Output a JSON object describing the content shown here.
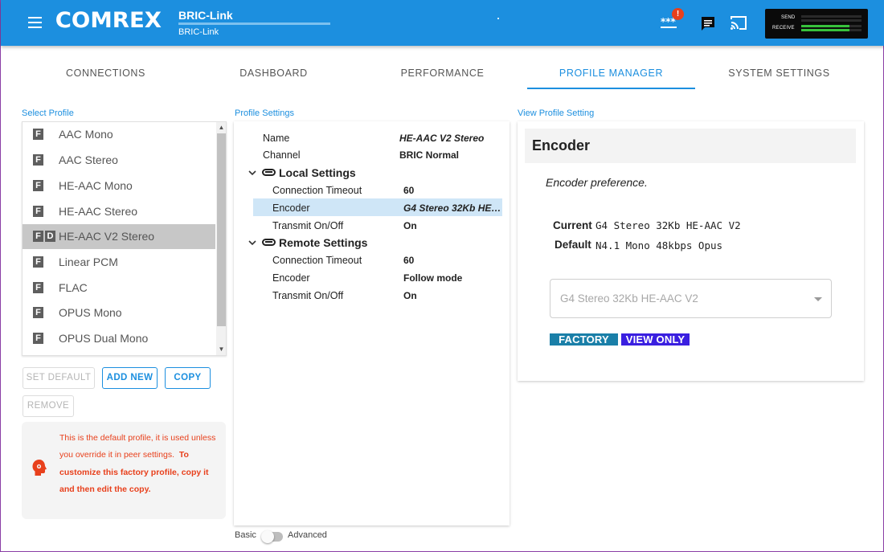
{
  "header": {
    "logo_text": "COMREX",
    "device_title": "BRIC-Link",
    "device_subtitle": "BRIC-Link",
    "alert_count": "!",
    "meter": {
      "send_label": "SEND",
      "receive_label": "RECEIVE",
      "send_level": 0.0,
      "receive_level": 0.8,
      "fill_color": "#38c23c"
    },
    "accent_color": "#1c8fdf"
  },
  "tabs": [
    {
      "label": "CONNECTIONS"
    },
    {
      "label": "DASHBOARD"
    },
    {
      "label": "PERFORMANCE"
    },
    {
      "label": "PROFILE MANAGER",
      "active": true
    },
    {
      "label": "SYSTEM SETTINGS"
    }
  ],
  "select_profile": {
    "label": "Select Profile",
    "items": [
      {
        "label": "AAC Mono",
        "badge": "F"
      },
      {
        "label": "AAC Stereo",
        "badge": "F"
      },
      {
        "label": "HE-AAC Mono",
        "badge": "F"
      },
      {
        "label": "HE-AAC Stereo",
        "badge": "F"
      },
      {
        "label": "HE-AAC V2 Stereo",
        "badge": "F",
        "badge2": "D",
        "selected": true
      },
      {
        "label": "Linear PCM",
        "badge": "F"
      },
      {
        "label": "FLAC",
        "badge": "F"
      },
      {
        "label": "OPUS Mono",
        "badge": "F"
      },
      {
        "label": "OPUS Dual Mono",
        "badge": "F"
      }
    ],
    "buttons": {
      "set_default": "SET DEFAULT",
      "add_new": "ADD NEW",
      "copy": "COPY",
      "remove": "REMOVE"
    },
    "info": {
      "text1": "This is the default profile, it is used unless you override it in peer settings.",
      "text2": "To customize this factory profile, copy it and then edit the copy."
    }
  },
  "profile_settings": {
    "label": "Profile Settings",
    "name_label": "Name",
    "name_value": "HE-AAC V2 Stereo",
    "channel_label": "Channel",
    "channel_value": "BRIC Normal",
    "local": {
      "title": "Local Settings",
      "rows": [
        {
          "label": "Connection Timeout",
          "value": "60"
        },
        {
          "label": "Encoder",
          "value": "G4 Stereo 32Kb HE…"
        },
        {
          "label": "Transmit On/Off",
          "value": "On"
        }
      ]
    },
    "remote": {
      "title": "Remote Settings",
      "rows": [
        {
          "label": "Connection Timeout",
          "value": "60"
        },
        {
          "label": "Encoder",
          "value": "Follow mode"
        },
        {
          "label": "Transmit On/Off",
          "value": "On"
        }
      ]
    },
    "toggle": {
      "left": "Basic",
      "right": "Advanced"
    }
  },
  "view_profile": {
    "label": "View Profile Setting",
    "heading": "Encoder",
    "description": "Encoder preference.",
    "current_label": "Current",
    "current_value": "G4 Stereo 32Kb HE-AAC V2",
    "default_label": "Default",
    "default_value": "N4.1 Mono 48kbps Opus",
    "select_value": "G4 Stereo 32Kb HE-AAC V2",
    "tags": [
      {
        "label": "FACTORY",
        "color": "#1a7fa8"
      },
      {
        "label": "VIEW ONLY",
        "color": "#3a1fe0"
      }
    ]
  }
}
